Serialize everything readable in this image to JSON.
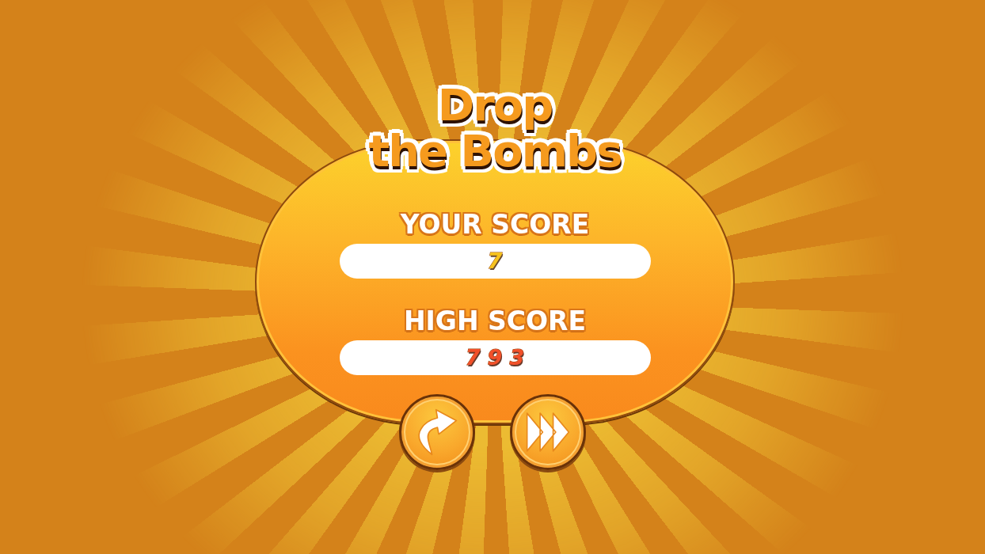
{
  "title": "Drop\nthe Bombs",
  "scores": [
    {
      "kind": "current",
      "label": "YOUR SCORE",
      "value": "7"
    },
    {
      "kind": "high",
      "label": "HIGH SCORE",
      "value": "793"
    }
  ]
}
